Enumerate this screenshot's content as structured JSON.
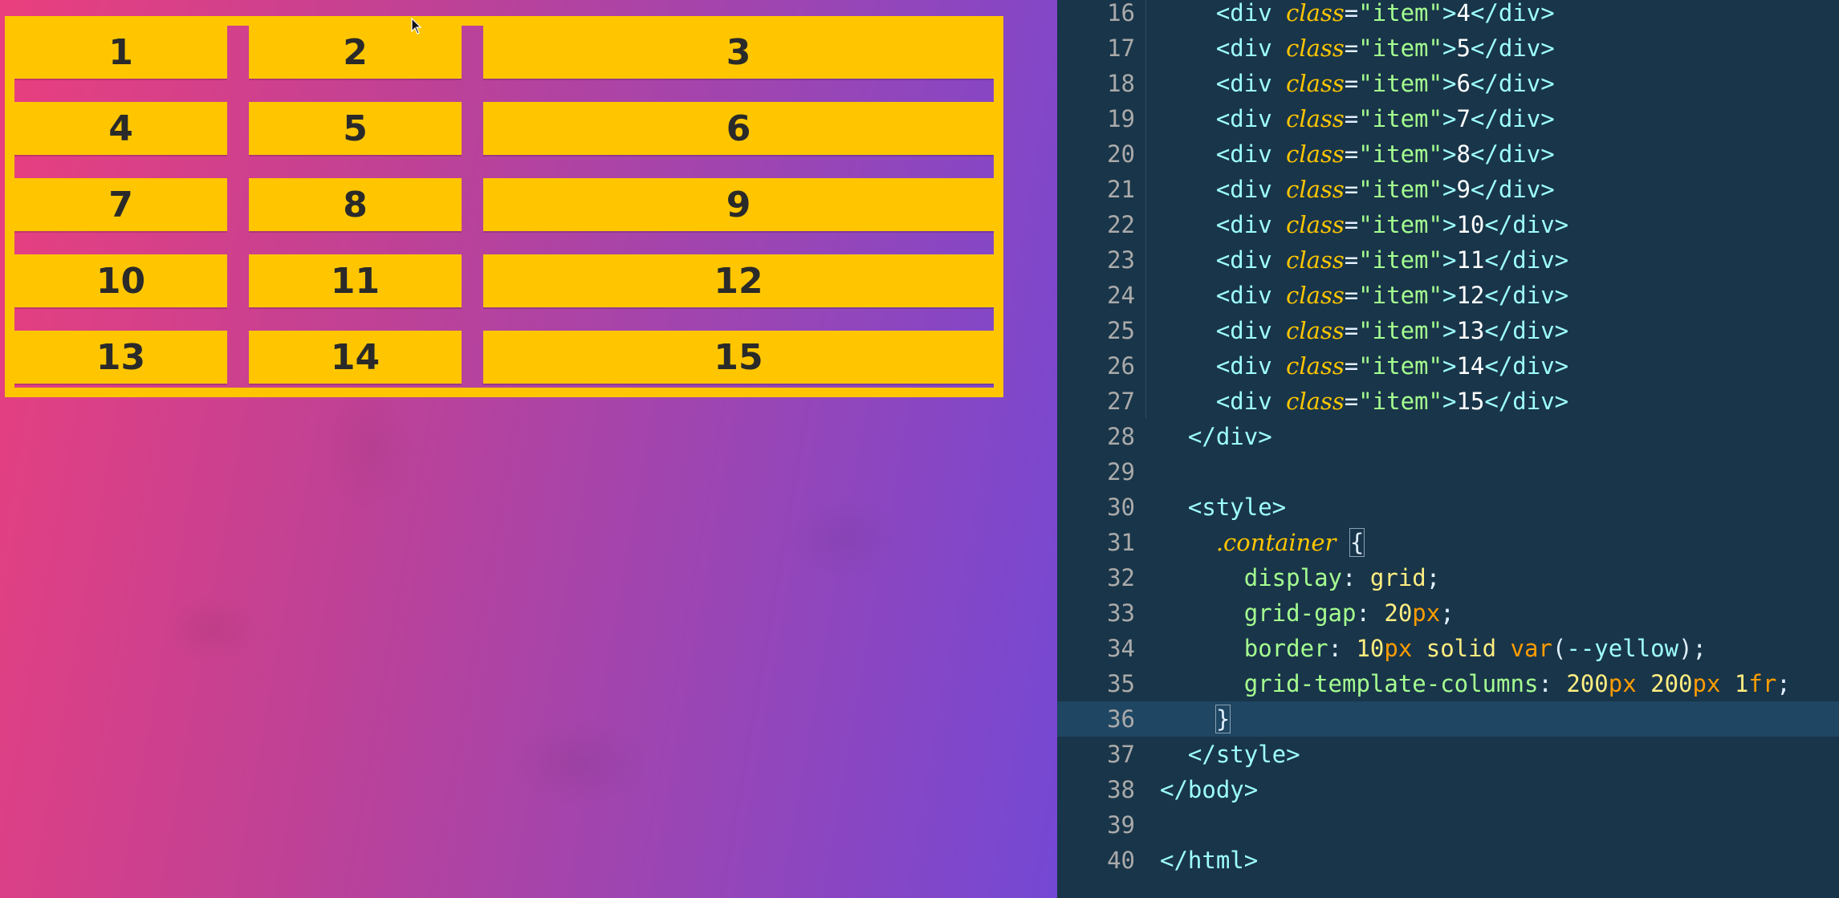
{
  "preview": {
    "grid_items": [
      "1",
      "2",
      "3",
      "4",
      "5",
      "6",
      "7",
      "8",
      "9",
      "10",
      "11",
      "12",
      "13",
      "14",
      "15"
    ]
  },
  "editor": {
    "line_numbers": [
      "16",
      "17",
      "18",
      "19",
      "20",
      "21",
      "22",
      "23",
      "24",
      "25",
      "26",
      "27",
      "28",
      "29",
      "30",
      "31",
      "32",
      "33",
      "34",
      "35",
      "36",
      "37",
      "38",
      "39",
      "40"
    ],
    "item_lines": [
      {
        "open": "<div ",
        "attr": "class",
        "eq": "=",
        "str": "\"item\"",
        "close_open": ">",
        "content": "4",
        "close": "</div>"
      },
      {
        "open": "<div ",
        "attr": "class",
        "eq": "=",
        "str": "\"item\"",
        "close_open": ">",
        "content": "5",
        "close": "</div>"
      },
      {
        "open": "<div ",
        "attr": "class",
        "eq": "=",
        "str": "\"item\"",
        "close_open": ">",
        "content": "6",
        "close": "</div>"
      },
      {
        "open": "<div ",
        "attr": "class",
        "eq": "=",
        "str": "\"item\"",
        "close_open": ">",
        "content": "7",
        "close": "</div>"
      },
      {
        "open": "<div ",
        "attr": "class",
        "eq": "=",
        "str": "\"item\"",
        "close_open": ">",
        "content": "8",
        "close": "</div>"
      },
      {
        "open": "<div ",
        "attr": "class",
        "eq": "=",
        "str": "\"item\"",
        "close_open": ">",
        "content": "9",
        "close": "</div>"
      },
      {
        "open": "<div ",
        "attr": "class",
        "eq": "=",
        "str": "\"item\"",
        "close_open": ">",
        "content": "10",
        "close": "</div>"
      },
      {
        "open": "<div ",
        "attr": "class",
        "eq": "=",
        "str": "\"item\"",
        "close_open": ">",
        "content": "11",
        "close": "</div>"
      },
      {
        "open": "<div ",
        "attr": "class",
        "eq": "=",
        "str": "\"item\"",
        "close_open": ">",
        "content": "12",
        "close": "</div>"
      },
      {
        "open": "<div ",
        "attr": "class",
        "eq": "=",
        "str": "\"item\"",
        "close_open": ">",
        "content": "13",
        "close": "</div>"
      },
      {
        "open": "<div ",
        "attr": "class",
        "eq": "=",
        "str": "\"item\"",
        "close_open": ">",
        "content": "14",
        "close": "</div>"
      },
      {
        "open": "<div ",
        "attr": "class",
        "eq": "=",
        "str": "\"item\"",
        "close_open": ">",
        "content": "15",
        "close": "</div>"
      }
    ],
    "close_div": "</div>",
    "style_open": "<style>",
    "selector": ".container",
    "brace_open": "{",
    "decl_display": {
      "prop": "display",
      "colon": ": ",
      "value": "grid",
      "semi": ";"
    },
    "decl_gap": {
      "prop": "grid-gap",
      "colon": ": ",
      "num": "20",
      "unit": "px",
      "semi": ";"
    },
    "decl_border": {
      "prop": "border",
      "colon": ": ",
      "num": "10",
      "unit": "px",
      "value": " solid ",
      "fn": "var",
      "paren_open": "(",
      "arg": "--yellow",
      "paren_close": ")",
      "semi": ";"
    },
    "decl_columns": {
      "prop": "grid-template-columns",
      "colon": ": ",
      "num1": "200",
      "unit1": "px",
      "num2": "200",
      "unit2": "px",
      "num3": "1",
      "unit3": "fr",
      "semi": ";"
    },
    "brace_close": "}",
    "style_close": "</style>",
    "body_close": "</body>",
    "html_close": "</html>"
  },
  "colors": {
    "editor_bg": "#193549",
    "yellow": "#ffc600",
    "tag": "#9effff",
    "string": "#a5ff90",
    "number": "#ff628c",
    "unit": "#ff9d00"
  },
  "icons": {
    "cursor": "mouse-pointer-icon"
  }
}
